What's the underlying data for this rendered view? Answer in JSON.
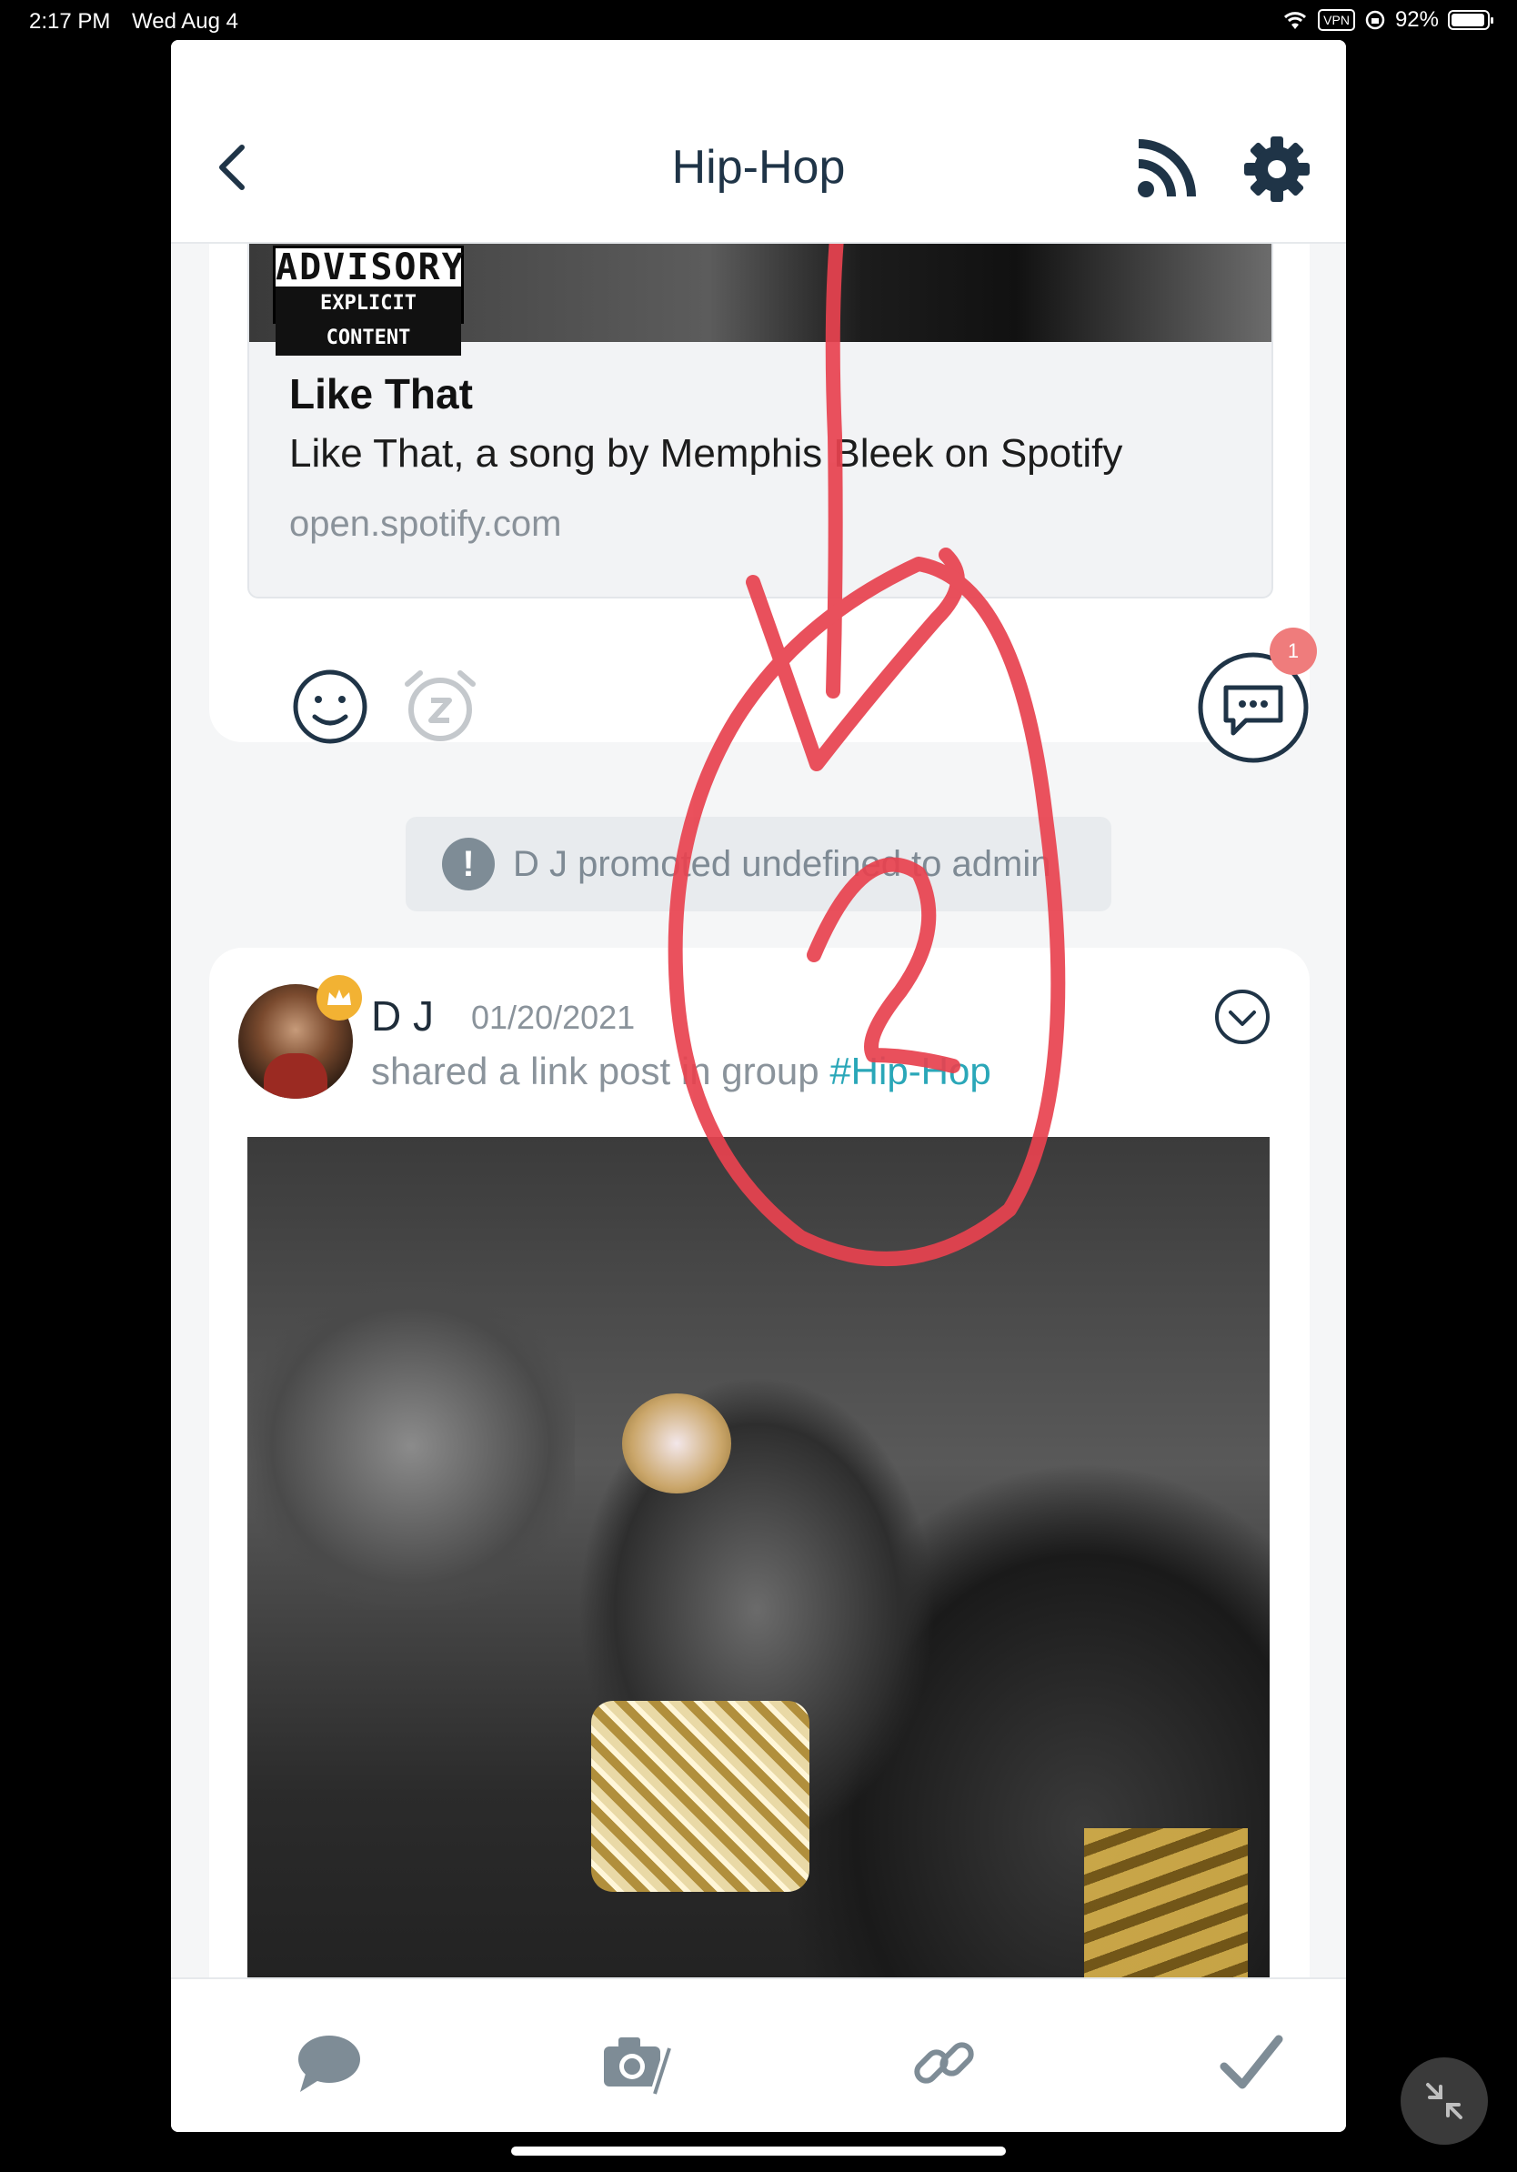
{
  "status_bar": {
    "time": "2:17 PM",
    "date": "Wed Aug 4",
    "vpn": "VPN",
    "battery": "92%"
  },
  "header": {
    "title": "Hip-Hop",
    "back_icon": "chevron-left-icon",
    "rss_icon": "rss-icon",
    "settings_icon": "gear-icon"
  },
  "link_card": {
    "advisory_top": "ADVISORY",
    "advisory_bottom": "EXPLICIT CONTENT",
    "title": "Like That",
    "description": "Like That, a song by Memphis Bleek on Spotify",
    "url": "open.spotify.com",
    "comment_count": "1"
  },
  "system_message": {
    "icon": "!",
    "text": "D J promoted undefined to admin"
  },
  "post": {
    "author": "D J",
    "date": "01/20/2021",
    "action_prefix": "shared a link post in group ",
    "group_tag": "#Hip-Hop"
  },
  "toolbar": {
    "items": [
      "chat-bubble-icon",
      "camera-icon",
      "link-icon",
      "checkmark-icon"
    ]
  },
  "colors": {
    "accent": "#2aa7b8",
    "badge": "#ef7c7c",
    "crown": "#f2b233",
    "annotation": "#e8424f"
  }
}
